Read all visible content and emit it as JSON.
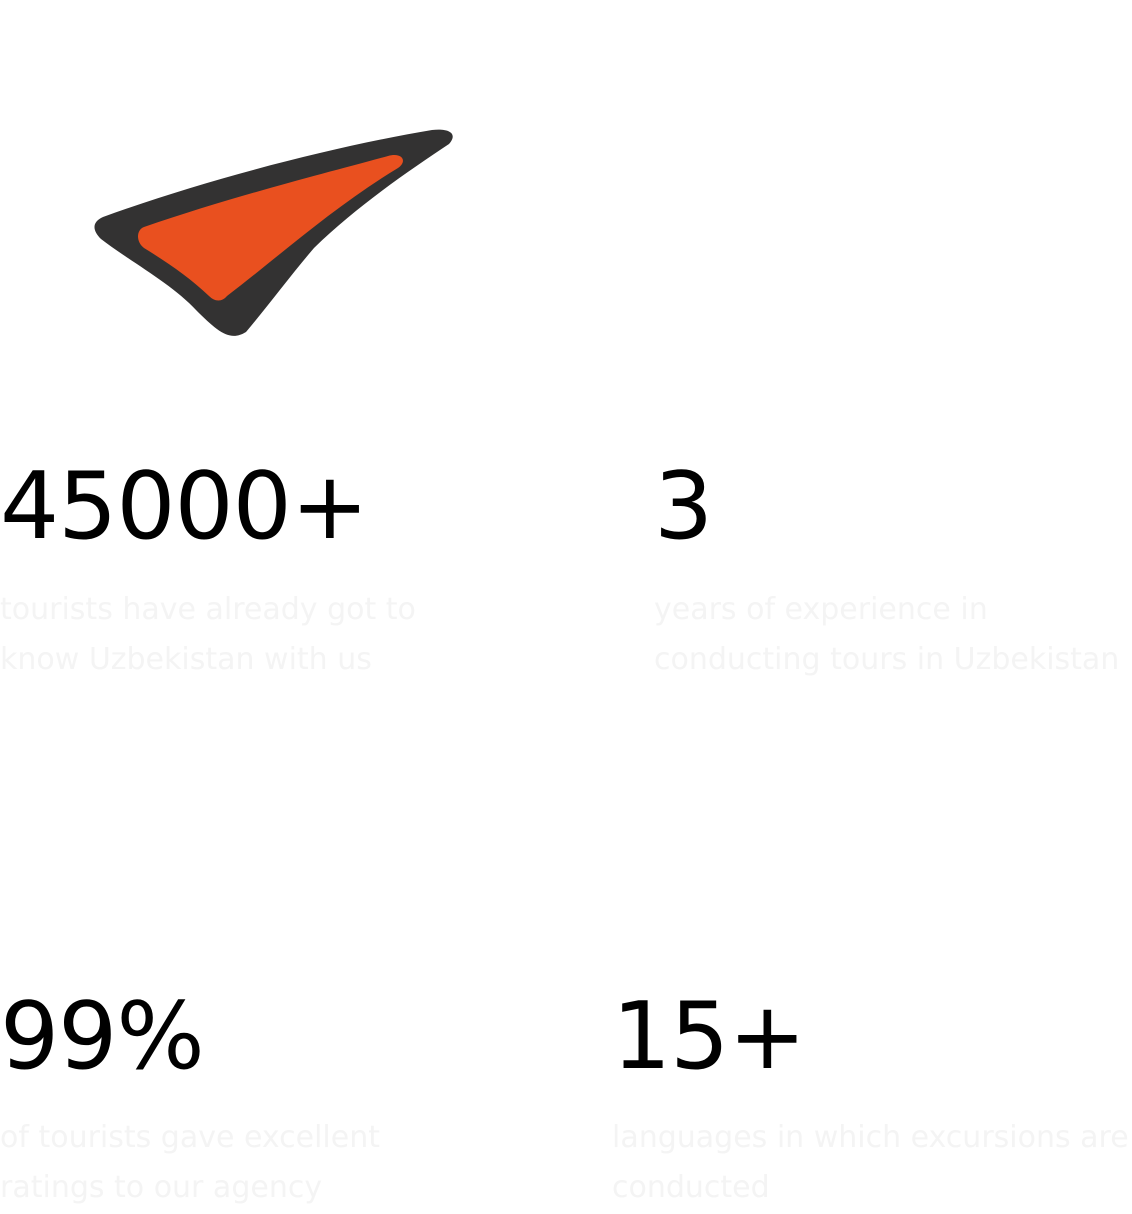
{
  "brand": {
    "logo_icon": "arrowhead-logo-icon",
    "colors": {
      "logo_dark": "#333232",
      "logo_accent": "#e9501f",
      "text": "#000000",
      "muted_text": "#f4f4f4"
    }
  },
  "stats": [
    {
      "value": "45000+",
      "description": "tourists have already got to know Uzbekistan with us"
    },
    {
      "value": "3",
      "description": "years of experience in conducting tours in Uzbekistan"
    },
    {
      "value": "99%",
      "description": "of tourists gave excellent ratings to our agency"
    },
    {
      "value": "15+",
      "description": "languages in which excursions are conducted"
    }
  ]
}
